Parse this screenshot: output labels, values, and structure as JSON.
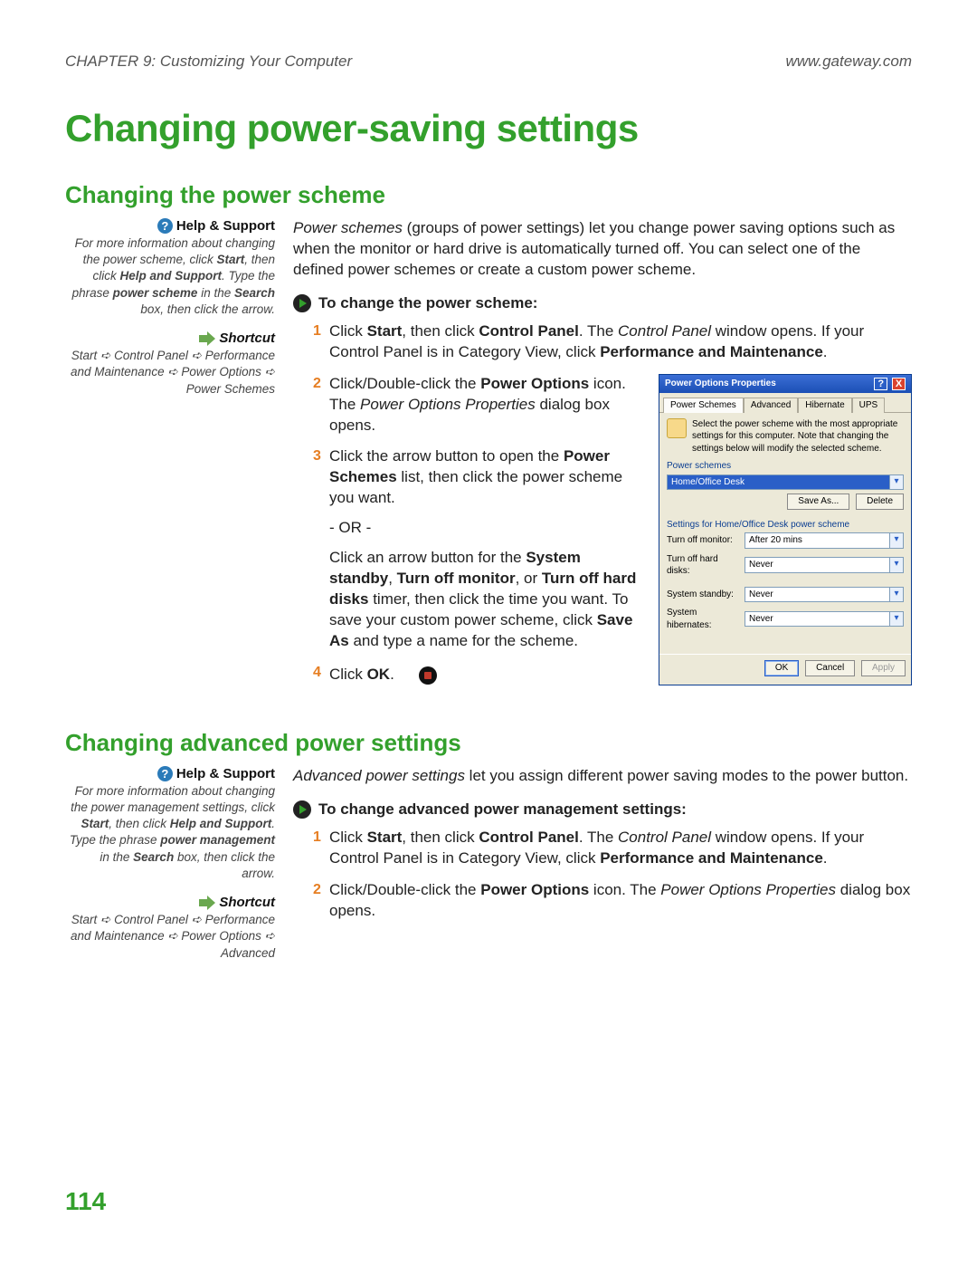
{
  "header": {
    "chapter": "CHAPTER 9: Customizing Your Computer",
    "site": "www.gateway.com"
  },
  "title": "Changing power-saving settings",
  "section1": {
    "heading": "Changing the power scheme",
    "help_label": "Help & Support",
    "help_text_pre": "For more information about changing the power scheme, click ",
    "help_b1": "Start",
    "help_mid1": ", then click ",
    "help_b2": "Help and Support",
    "help_mid2": ". Type the phrase ",
    "help_b3": "power scheme",
    "help_mid3": " in the ",
    "help_b4": "Search",
    "help_post": " box, then click the arrow.",
    "shortcut_label": "Shortcut",
    "shortcut_text": "Start ➪ Control Panel ➪ Performance and Maintenance ➪ Power Options ➪ Power Schemes",
    "intro_i": "Power schemes",
    "intro_rest": " (groups of power settings) let you change power saving options such as when the monitor or hard drive is automatically turned off. You can select one of the defined power schemes or create a custom power scheme.",
    "task_heading": "To change the power scheme:",
    "step1_a": "Click ",
    "step1_b1": "Start",
    "step1_b": ", then click ",
    "step1_b2": "Control Panel",
    "step1_c": ". The ",
    "step1_i": "Control Panel",
    "step1_d": " window opens. If your Control Panel is in Category View, click ",
    "step1_b3": "Performance and Maintenance",
    "step1_e": ".",
    "step2_a": "Click/Double-click the ",
    "step2_b1": "Power Options",
    "step2_b": " icon. The ",
    "step2_i": "Power Options Properties",
    "step2_c": " dialog box opens.",
    "step3_a": "Click the arrow button to open the ",
    "step3_b1": "Power Schemes",
    "step3_b": " list, then click the power scheme you want.",
    "step3_or": "- OR -",
    "step3_alt_a": "Click an arrow button for the ",
    "step3_alt_b1": "System standby",
    "step3_alt_s1": ", ",
    "step3_alt_b2": "Turn off monitor",
    "step3_alt_s2": ", or ",
    "step3_alt_b3": "Turn off hard disks",
    "step3_alt_b": " timer, then click the time you want. To save your custom power scheme, click ",
    "step3_alt_b4": "Save As",
    "step3_alt_c": " and type a name for the scheme.",
    "step4_a": "Click ",
    "step4_b1": "OK",
    "step4_b": "."
  },
  "dialog": {
    "title": "Power Options Properties",
    "tabs": [
      "Power Schemes",
      "Advanced",
      "Hibernate",
      "UPS"
    ],
    "info": "Select the power scheme with the most appropriate settings for this computer. Note that changing the settings below will modify the selected scheme.",
    "group1": "Power schemes",
    "scheme_value": "Home/Office Desk",
    "save_as": "Save As...",
    "delete": "Delete",
    "group2": "Settings for Home/Office Desk power scheme",
    "rows": [
      {
        "label": "Turn off monitor:",
        "value": "After 20 mins"
      },
      {
        "label": "Turn off hard disks:",
        "value": "Never"
      },
      {
        "label": "System standby:",
        "value": "Never"
      },
      {
        "label": "System hibernates:",
        "value": "Never"
      }
    ],
    "ok": "OK",
    "cancel": "Cancel",
    "apply": "Apply"
  },
  "section2": {
    "heading": "Changing advanced power settings",
    "help_label": "Help & Support",
    "help_text_pre": "For more information about changing the power management settings, click ",
    "help_b1": "Start",
    "help_mid1": ", then click ",
    "help_b2": "Help and Support",
    "help_mid2": ". Type the phrase ",
    "help_b3": "power management",
    "help_mid3": " in the ",
    "help_b4": "Search",
    "help_post": " box, then click the arrow.",
    "shortcut_label": "Shortcut",
    "shortcut_text": "Start ➪ Control Panel ➪ Performance and Maintenance ➪ Power Options ➪ Advanced",
    "intro_i": "Advanced power settings",
    "intro_rest": " let you assign different power saving modes to the power button.",
    "task_heading": "To change advanced power management settings:",
    "step1_a": "Click ",
    "step1_b1": "Start",
    "step1_b": ", then click ",
    "step1_b2": "Control Panel",
    "step1_c": ". The ",
    "step1_i": "Control Panel",
    "step1_d": " window opens. If your Control Panel is in Category View, click ",
    "step1_b3": "Performance and Maintenance",
    "step1_e": ".",
    "step2_a": "Click/Double-click the ",
    "step2_b1": "Power Options",
    "step2_b": " icon. The ",
    "step2_i": "Power Options Properties",
    "step2_c": " dialog box opens."
  },
  "page_number": "114"
}
